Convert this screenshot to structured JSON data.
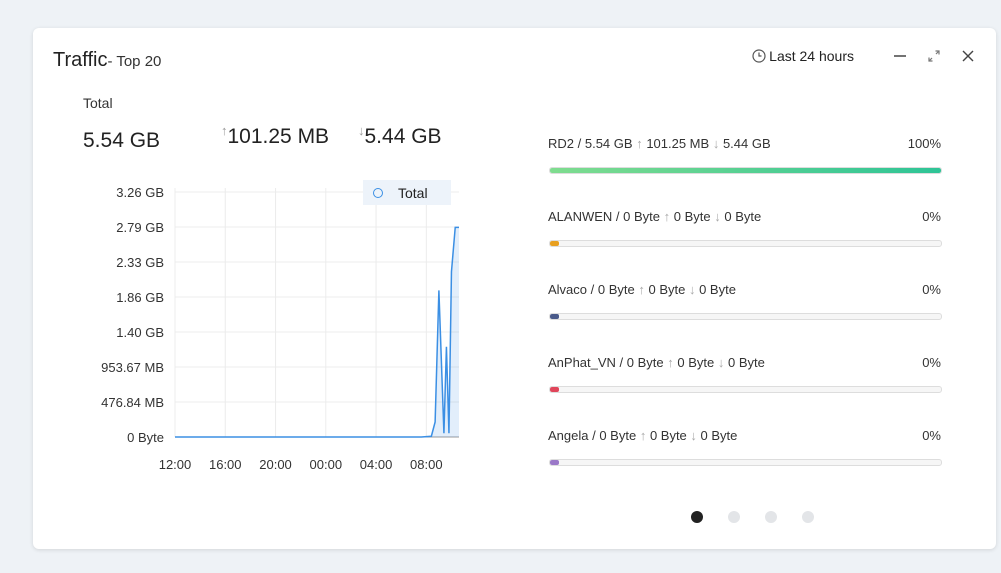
{
  "widget": {
    "title": "Traffic",
    "subtitle": "- Top 20",
    "time_range": "Last 24 hours"
  },
  "summary": {
    "label": "Total",
    "total": "5.54 GB",
    "upload": "101.25 MB",
    "download": "5.44 GB"
  },
  "chart_data": {
    "type": "line",
    "legend": [
      "Total"
    ],
    "legend_placement": "top-right",
    "grid": true,
    "y_tick_labels": [
      "3.26 GB",
      "2.79 GB",
      "2.33 GB",
      "1.86 GB",
      "1.40 GB",
      "953.67 MB",
      "476.84 MB",
      "0 Byte"
    ],
    "x_tick_labels": [
      "12:00",
      "16:00",
      "20:00",
      "00:00",
      "04:00",
      "08:00"
    ],
    "ylim_gb": [
      0,
      3.26
    ],
    "series": [
      {
        "name": "Total",
        "color": "#3b8fe4",
        "x_hours": [
          0,
          4,
          8,
          12,
          16,
          19.6,
          20.4,
          20.7,
          21.0,
          21.4,
          21.6,
          21.8,
          22.0,
          22.3,
          22.6
        ],
        "y_gb": [
          0.0,
          0.0,
          0.0,
          0.0,
          0.0,
          0.0,
          0.01,
          0.2,
          1.95,
          0.05,
          1.2,
          0.05,
          2.2,
          2.79,
          2.79
        ]
      }
    ]
  },
  "top_list": [
    {
      "name": "RD2",
      "total": "5.54 GB",
      "up": "101.25 MB",
      "down": "5.44 GB",
      "percent": "100%",
      "fill": 1.0,
      "color": "#2ec496"
    },
    {
      "name": "ALANWEN",
      "total": "0 Byte",
      "up": "0 Byte",
      "down": "0 Byte",
      "percent": "0%",
      "fill": 0.0,
      "color": "#e8a020"
    },
    {
      "name": "Alvaco",
      "total": "0 Byte",
      "up": "0 Byte",
      "down": "0 Byte",
      "percent": "0%",
      "fill": 0.0,
      "color": "#4a5a8a"
    },
    {
      "name": "AnPhat_VN",
      "total": "0 Byte",
      "up": "0 Byte",
      "down": "0 Byte",
      "percent": "0%",
      "fill": 0.0,
      "color": "#e0455a"
    },
    {
      "name": "Angela",
      "total": "0 Byte",
      "up": "0 Byte",
      "down": "0 Byte",
      "percent": "0%",
      "fill": 0.0,
      "color": "#9a78c8"
    }
  ],
  "pagination": {
    "pages": 4,
    "active": 0
  },
  "icons": {
    "clock": "clock-icon",
    "minimize": "minimize-icon",
    "expand": "expand-icon",
    "close": "close-icon"
  }
}
